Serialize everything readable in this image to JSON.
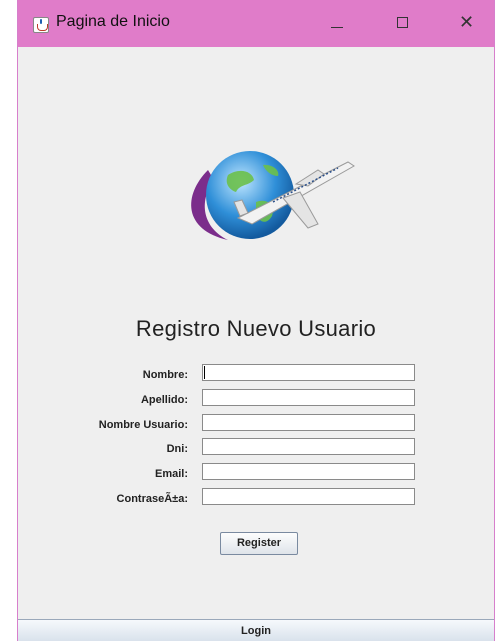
{
  "window": {
    "title": "Pagina de Inicio",
    "minimize_glyph": "—",
    "maximize_glyph": "☐",
    "close_glyph": "✕"
  },
  "logo": {
    "icon": "airplane-globe-logo",
    "colors": {
      "globe": "#2f8fd8",
      "swoosh": "#7b2d8b",
      "land": "#6cc04a"
    }
  },
  "form": {
    "heading": "Registro Nuevo Usuario",
    "fields": [
      {
        "label": "Nombre:",
        "value": ""
      },
      {
        "label": "Apellido:",
        "value": ""
      },
      {
        "label": "Nombre Usuario:",
        "value": ""
      },
      {
        "label": "Dni:",
        "value": ""
      },
      {
        "label": "Email:",
        "value": ""
      },
      {
        "label": "ContraseÃ±a:",
        "value": ""
      }
    ],
    "register_label": "Register"
  },
  "footer": {
    "login_label": "Login"
  },
  "colors": {
    "titlebar": "#e07cc9",
    "window_bg": "#efefef"
  }
}
